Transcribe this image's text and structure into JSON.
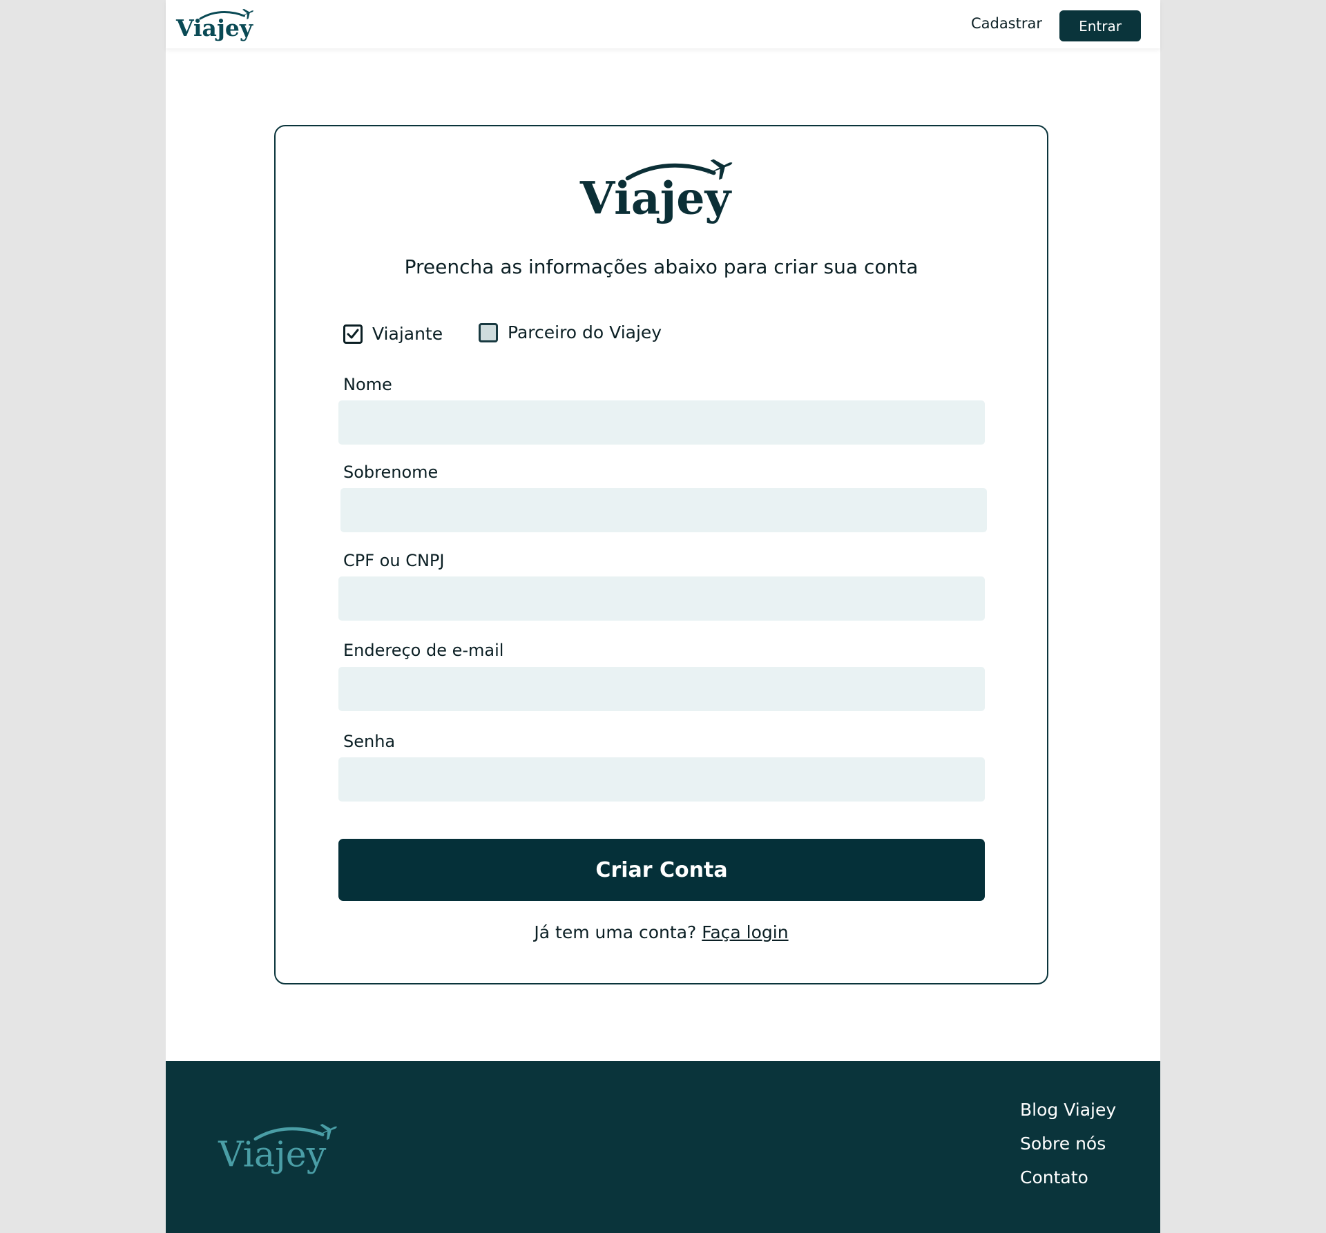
{
  "brand": {
    "name": "Viajey",
    "color_primary": "#0a343b",
    "color_footer_logo": "#4a9ea6",
    "color_input_bg": "#e9f2f3"
  },
  "header": {
    "register_label": "Cadastrar",
    "login_label": "Entrar"
  },
  "form": {
    "subtitle": "Preencha as informações abaixo para criar sua conta",
    "account_types": [
      {
        "label": "Viajante",
        "checked": true
      },
      {
        "label": "Parceiro do Viajey",
        "checked": false
      }
    ],
    "fields": [
      {
        "label": "Nome",
        "value": ""
      },
      {
        "label": "Sobrenome",
        "value": ""
      },
      {
        "label": "CPF ou CNPJ",
        "value": ""
      },
      {
        "label": "Endereço de e-mail",
        "value": ""
      },
      {
        "label": "Senha",
        "value": ""
      }
    ],
    "submit_label": "Criar Conta",
    "login_prompt": "Já tem uma conta?",
    "login_link": "Faça login"
  },
  "footer": {
    "links": [
      "Blog Viajey",
      "Sobre nós",
      "Contato"
    ]
  }
}
